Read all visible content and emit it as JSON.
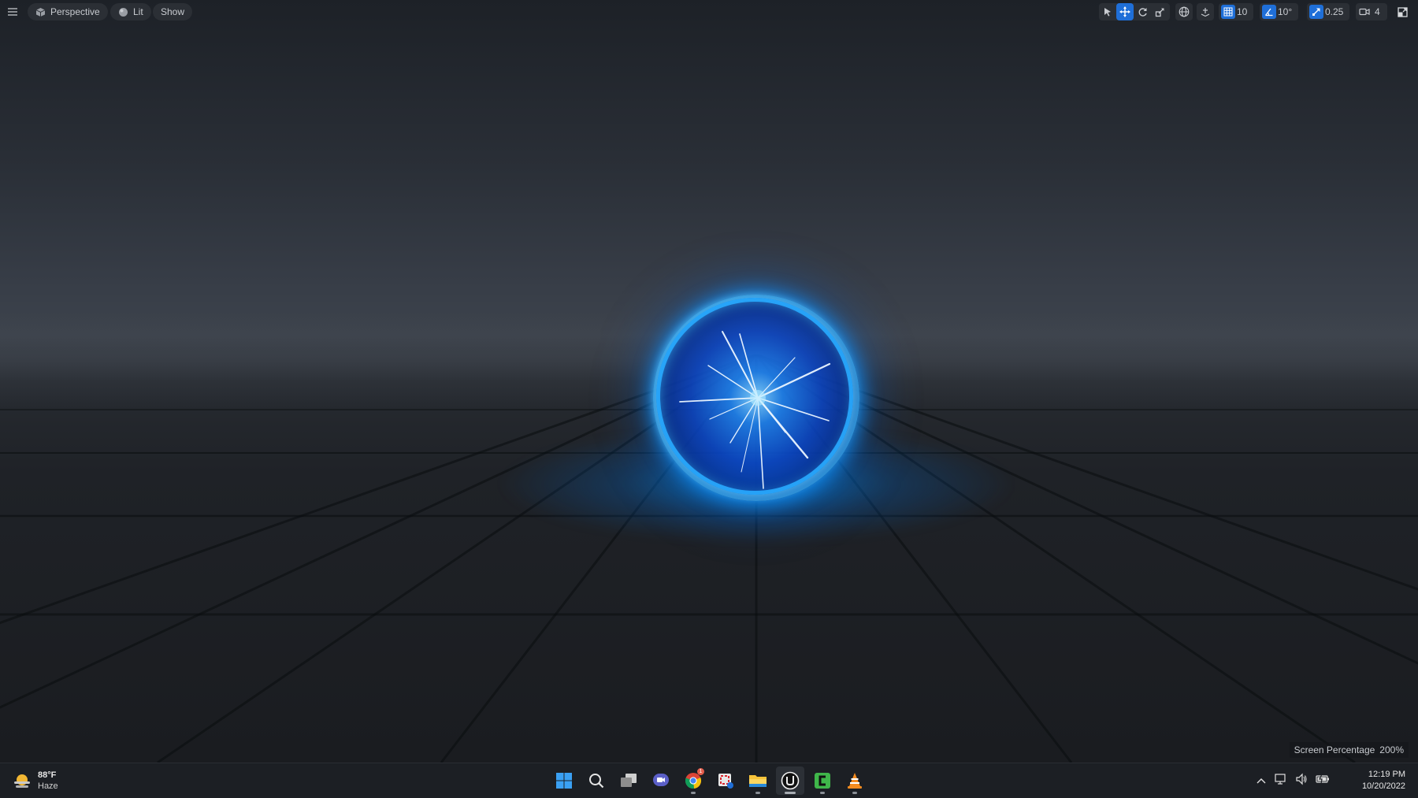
{
  "viewport_toolbar": {
    "menu_icon": "hamburger-icon",
    "perspective_label": "Perspective",
    "lit_label": "Lit",
    "show_label": "Show",
    "grid_snap_value": "10",
    "rotation_snap_value": "10°",
    "scale_snap_value": "0.25",
    "camera_speed_value": "4"
  },
  "screen_percentage": {
    "label": "Screen Percentage",
    "value": "200%"
  },
  "taskbar": {
    "weather": {
      "temperature": "88°F",
      "condition": "Haze"
    },
    "apps": [
      {
        "name": "start",
        "icon": "windows-start-icon"
      },
      {
        "name": "search",
        "icon": "search-icon"
      },
      {
        "name": "task-view",
        "icon": "task-view-icon"
      },
      {
        "name": "chat",
        "icon": "chat-icon"
      },
      {
        "name": "chrome",
        "icon": "chrome-icon",
        "badge": "1"
      },
      {
        "name": "snipping-tool",
        "icon": "snipping-tool-icon"
      },
      {
        "name": "file-explorer",
        "icon": "folder-icon"
      },
      {
        "name": "unreal-engine",
        "icon": "unreal-engine-icon"
      },
      {
        "name": "camtasia",
        "icon": "camtasia-icon"
      },
      {
        "name": "vlc",
        "icon": "vlc-icon"
      }
    ],
    "clock": {
      "time": "12:19 PM",
      "date": "10/20/2022"
    }
  },
  "colors": {
    "accent_blue": "#1f6fd8",
    "orb_core": "#1e82f0",
    "orb_ring": "#28aaff",
    "toolbar_bg": "#2b2f35",
    "taskbar_bg": "#1c1f24"
  }
}
